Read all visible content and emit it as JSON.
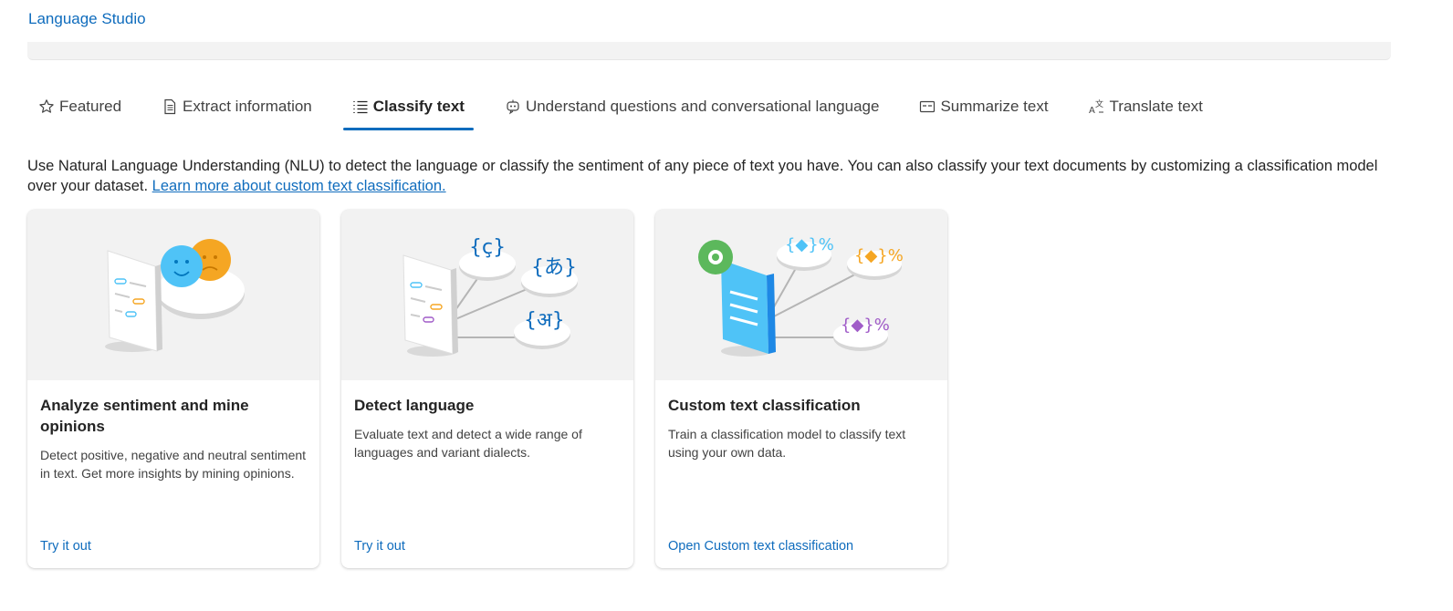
{
  "app": {
    "title": "Language Studio"
  },
  "tabs": [
    {
      "label": "Featured",
      "icon": "star-icon",
      "active": false
    },
    {
      "label": "Extract information",
      "icon": "document-icon",
      "active": false
    },
    {
      "label": "Classify text",
      "icon": "list-icon",
      "active": true
    },
    {
      "label": "Understand questions and conversational language",
      "icon": "chat-bot-icon",
      "active": false
    },
    {
      "label": "Summarize text",
      "icon": "summary-icon",
      "active": false
    },
    {
      "label": "Translate text",
      "icon": "translate-icon",
      "active": false
    }
  ],
  "description": {
    "text": "Use Natural Language Understanding (NLU) to detect the language or classify the sentiment of any piece of text you have. You can also classify your text documents by customizing a classification model over your dataset. ",
    "link": "Learn more about custom text classification."
  },
  "cards": [
    {
      "title": "Analyze sentiment and mine opinions",
      "text": "Detect positive, negative and neutral sentiment in text. Get more insights by mining opinions.",
      "link": "Try it out",
      "illustration": "sentiment-illustration"
    },
    {
      "title": "Detect language",
      "text": "Evaluate text and detect a wide range of languages and variant dialects.",
      "link": "Try it out",
      "illustration": "language-illustration"
    },
    {
      "title": "Custom text classification",
      "text": "Train a classification model to classify text using your own data.",
      "link": "Open Custom text classification",
      "illustration": "classification-illustration"
    }
  ],
  "colors": {
    "accent": "#0f6cbd",
    "card_image_bg": "#f2f2f2"
  }
}
